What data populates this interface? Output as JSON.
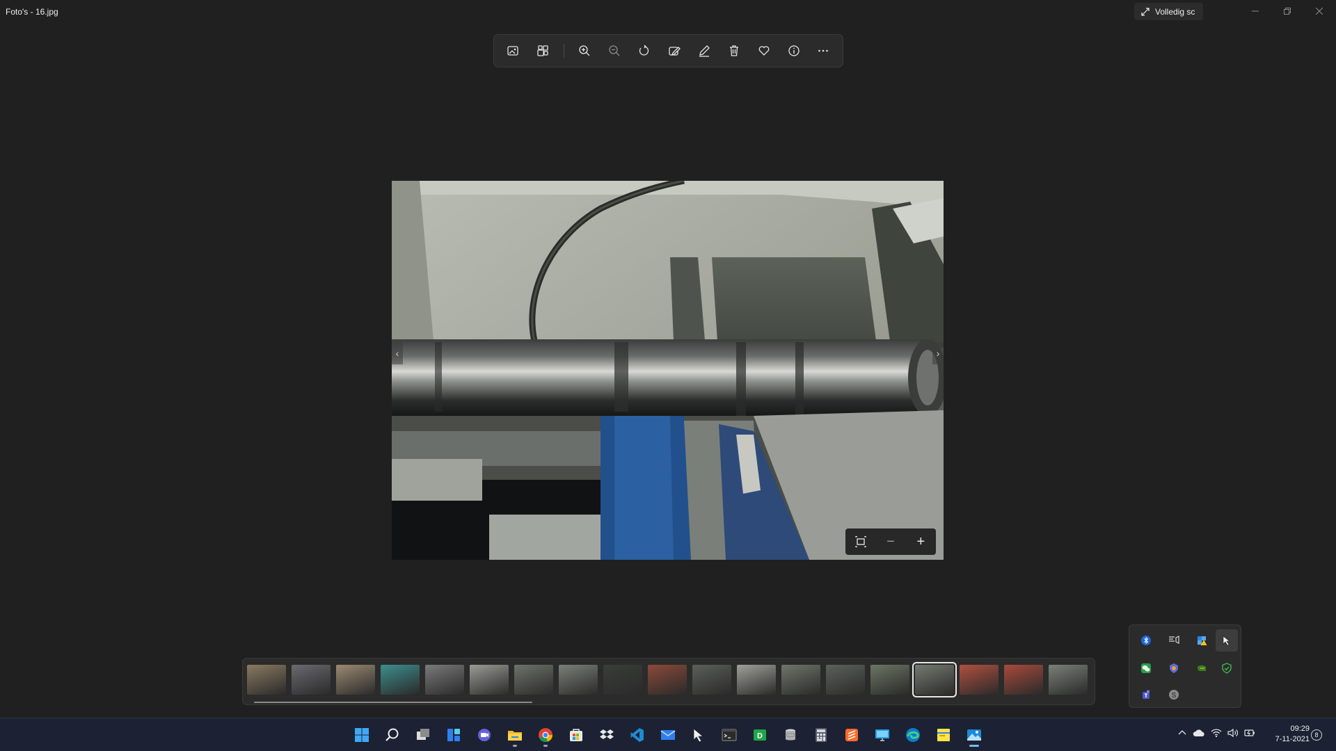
{
  "window": {
    "title": "Foto's - 16.jpg",
    "fullscreen_label": "Volledig sc"
  },
  "toolbar": {
    "buttons": [
      {
        "name": "view-image-icon"
      },
      {
        "name": "edit-image-icon"
      },
      {
        "name": "zoom-in-icon"
      },
      {
        "name": "zoom-out-icon"
      },
      {
        "name": "rotate-icon"
      },
      {
        "name": "edit-crop-icon"
      },
      {
        "name": "draw-pen-icon"
      },
      {
        "name": "delete-icon"
      },
      {
        "name": "favorite-heart-icon"
      },
      {
        "name": "info-icon"
      },
      {
        "name": "more-options-icon"
      }
    ]
  },
  "viewer": {
    "prev_arrow": "‹",
    "next_arrow": "›",
    "zoom_minus": "−",
    "zoom_plus": "+"
  },
  "filmstrip": {
    "thumbs": [
      {
        "color": "#8a7a60"
      },
      {
        "color": "#6a6a70"
      },
      {
        "color": "#9b8a72"
      },
      {
        "color": "#3d8e8c"
      },
      {
        "color": "#7a7a7a"
      },
      {
        "color": "#9a9a96"
      },
      {
        "color": "#6f726a"
      },
      {
        "color": "#7c7f78"
      },
      {
        "color": "#3a3d3a"
      },
      {
        "color": "#8a4a3a"
      },
      {
        "color": "#5c5f5a"
      },
      {
        "color": "#a0a09a"
      },
      {
        "color": "#6f766a"
      },
      {
        "color": "#5d615a"
      },
      {
        "color": "#6c7563"
      },
      {
        "color": "#767a70"
      },
      {
        "color": "#b05040"
      },
      {
        "color": "#a84a3c"
      },
      {
        "color": "#7a8078"
      }
    ],
    "selected_index": 15
  },
  "tray_popup": {
    "icons": [
      "bluetooth-icon",
      "display-icon",
      "security-warning-icon",
      "pen-cursor-icon",
      "wechat-icon",
      "vpn-shield-icon",
      "nvidia-icon",
      "defender-icon",
      "teams-icon",
      "skype-icon"
    ]
  },
  "taskbar": {
    "apps": [
      {
        "name": "start-icon",
        "running": false
      },
      {
        "name": "search-icon",
        "running": false
      },
      {
        "name": "task-view-icon",
        "running": false
      },
      {
        "name": "widgets-icon",
        "running": false
      },
      {
        "name": "chat-icon",
        "running": false
      },
      {
        "name": "file-explorer-icon",
        "running": true
      },
      {
        "name": "chrome-icon",
        "running": true
      },
      {
        "name": "store-icon",
        "running": false
      },
      {
        "name": "dropbox-icon",
        "running": false
      },
      {
        "name": "visual-studio-code-icon",
        "running": false
      },
      {
        "name": "mail-icon",
        "running": false
      },
      {
        "name": "inkscape-icon",
        "running": false
      },
      {
        "name": "terminal-icon",
        "running": false
      },
      {
        "name": "app-green-icon",
        "running": false
      },
      {
        "name": "database-icon",
        "running": false
      },
      {
        "name": "calculator-icon",
        "running": false
      },
      {
        "name": "sublime-icon",
        "running": false
      },
      {
        "name": "remote-desktop-icon",
        "running": false
      },
      {
        "name": "edge-icon",
        "running": false
      },
      {
        "name": "sticky-explorer-icon",
        "running": false
      },
      {
        "name": "photos-icon",
        "running": true,
        "active": true
      }
    ],
    "clock_time": "09:29",
    "clock_date": "7-11-2021",
    "notification_count": "8"
  }
}
